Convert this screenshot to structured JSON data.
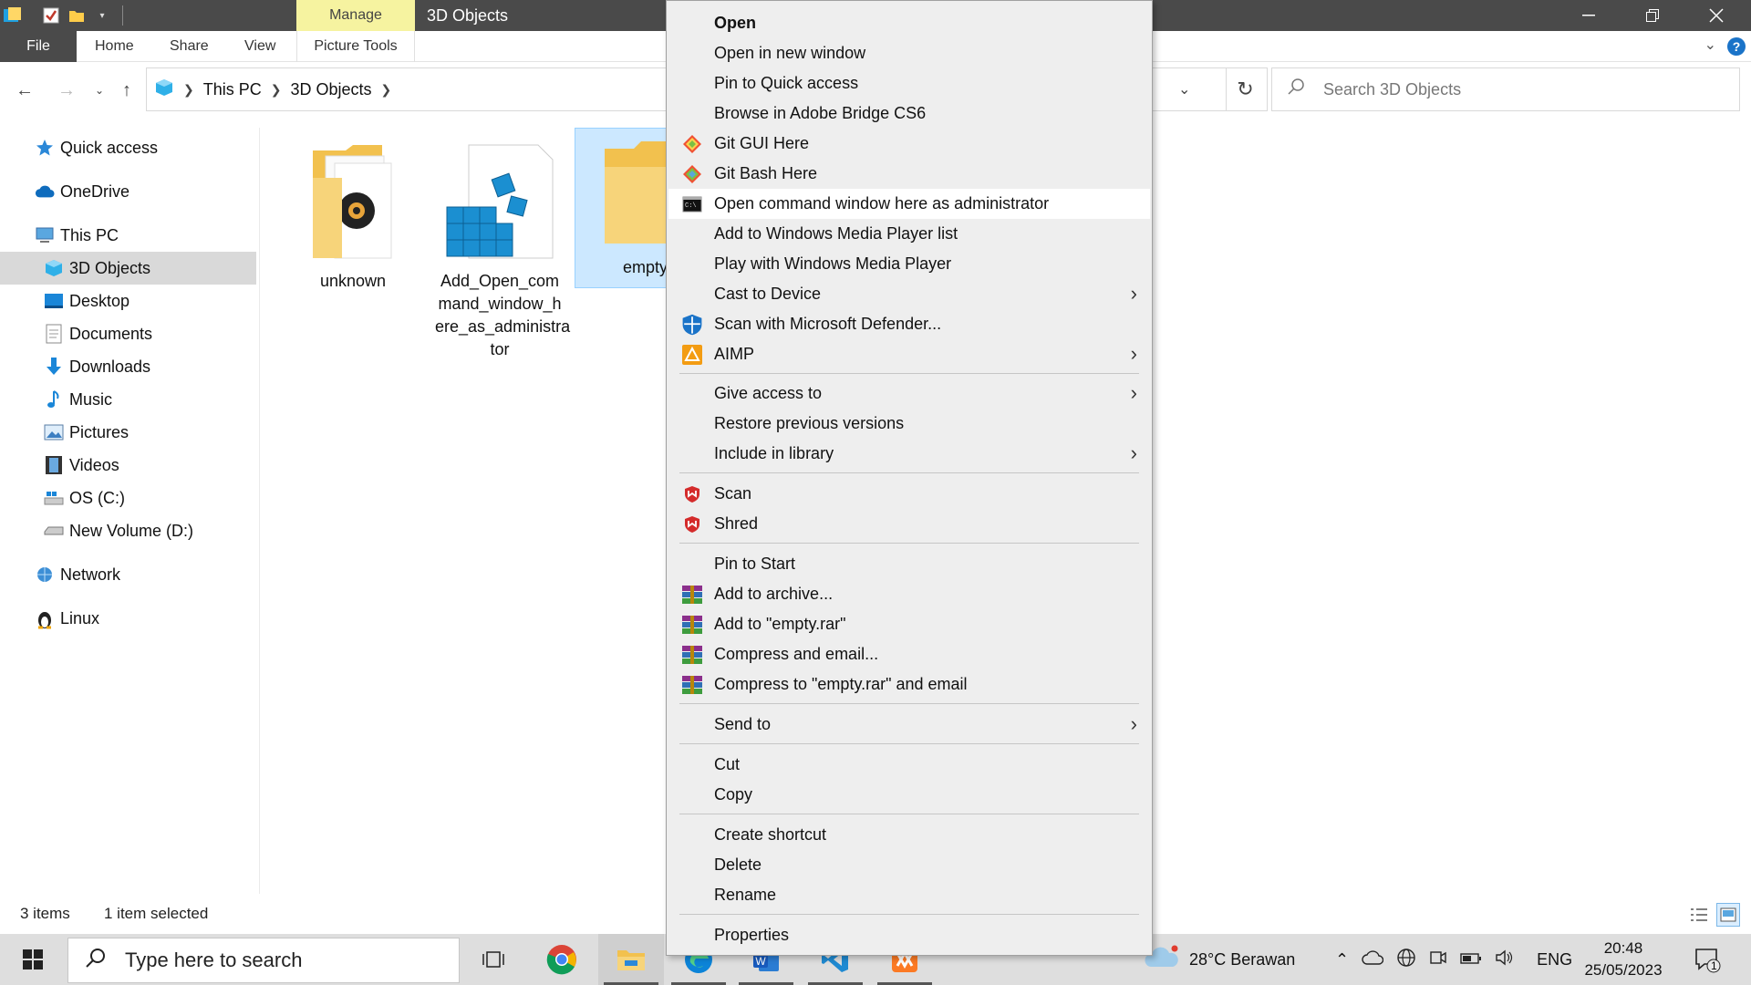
{
  "window": {
    "title": "3D Objects",
    "context_tab": "Manage",
    "context_tab_sub": "Picture Tools"
  },
  "ribbon": {
    "tabs": [
      "File",
      "Home",
      "Share",
      "View"
    ]
  },
  "address": {
    "crumbs": [
      "This PC",
      "3D Objects"
    ],
    "search_placeholder": "Search 3D Objects"
  },
  "nav": {
    "items": [
      {
        "label": "Quick access",
        "icon": "star-icon"
      },
      {
        "label": "OneDrive",
        "icon": "cloud-icon"
      },
      {
        "label": "This PC",
        "icon": "computer-icon"
      },
      {
        "label": "3D Objects",
        "icon": "cube-icon",
        "selected": true
      },
      {
        "label": "Desktop",
        "icon": "desktop-icon"
      },
      {
        "label": "Documents",
        "icon": "document-icon"
      },
      {
        "label": "Downloads",
        "icon": "download-icon"
      },
      {
        "label": "Music",
        "icon": "music-icon"
      },
      {
        "label": "Pictures",
        "icon": "pictures-icon"
      },
      {
        "label": "Videos",
        "icon": "video-icon"
      },
      {
        "label": "OS (C:)",
        "icon": "drive-icon"
      },
      {
        "label": "New Volume (D:)",
        "icon": "drive-icon"
      },
      {
        "label": "Network",
        "icon": "network-icon"
      },
      {
        "label": "Linux",
        "icon": "linux-icon"
      }
    ]
  },
  "files": [
    {
      "name": "unknown"
    },
    {
      "name": "Add_Open_command_window_here_as_administrator",
      "lines": [
        "Add_Open_com",
        "mand_window_h",
        "ere_as_administra",
        "tor"
      ]
    },
    {
      "name": "empty",
      "visible": "empty",
      "selected": true
    }
  ],
  "status": {
    "items": "3 items",
    "selected": "1 item selected"
  },
  "context_menu": {
    "items": [
      "Open",
      "Open in new window",
      "Pin to Quick access",
      "Browse in Adobe Bridge CS6",
      "Git GUI Here",
      "Git Bash Here",
      "Open command window here as administrator",
      "Add to Windows Media Player list",
      "Play with Windows Media Player",
      "Cast to Device",
      "Scan with Microsoft Defender...",
      "AIMP",
      "Give access to",
      "Restore previous versions",
      "Include in library",
      "Scan",
      "Shred",
      "Pin to Start",
      "Add to archive...",
      "Add to \"empty.rar\"",
      "Compress and email...",
      "Compress to \"empty.rar\" and email",
      "Send to",
      "Cut",
      "Copy",
      "Create shortcut",
      "Delete",
      "Rename",
      "Properties"
    ],
    "hovered": "Open command window here as administrator"
  },
  "taskbar": {
    "search_placeholder": "Type here to search",
    "weather": "28°C  Berawan",
    "language": "ENG",
    "time": "20:48",
    "date": "25/05/2023",
    "notification_count": "1"
  },
  "colors": {
    "titlebar": "#4a4a4a",
    "manage_tab": "#f6f3a0",
    "selection": "#cce8ff",
    "accent": "#1a73c8"
  }
}
